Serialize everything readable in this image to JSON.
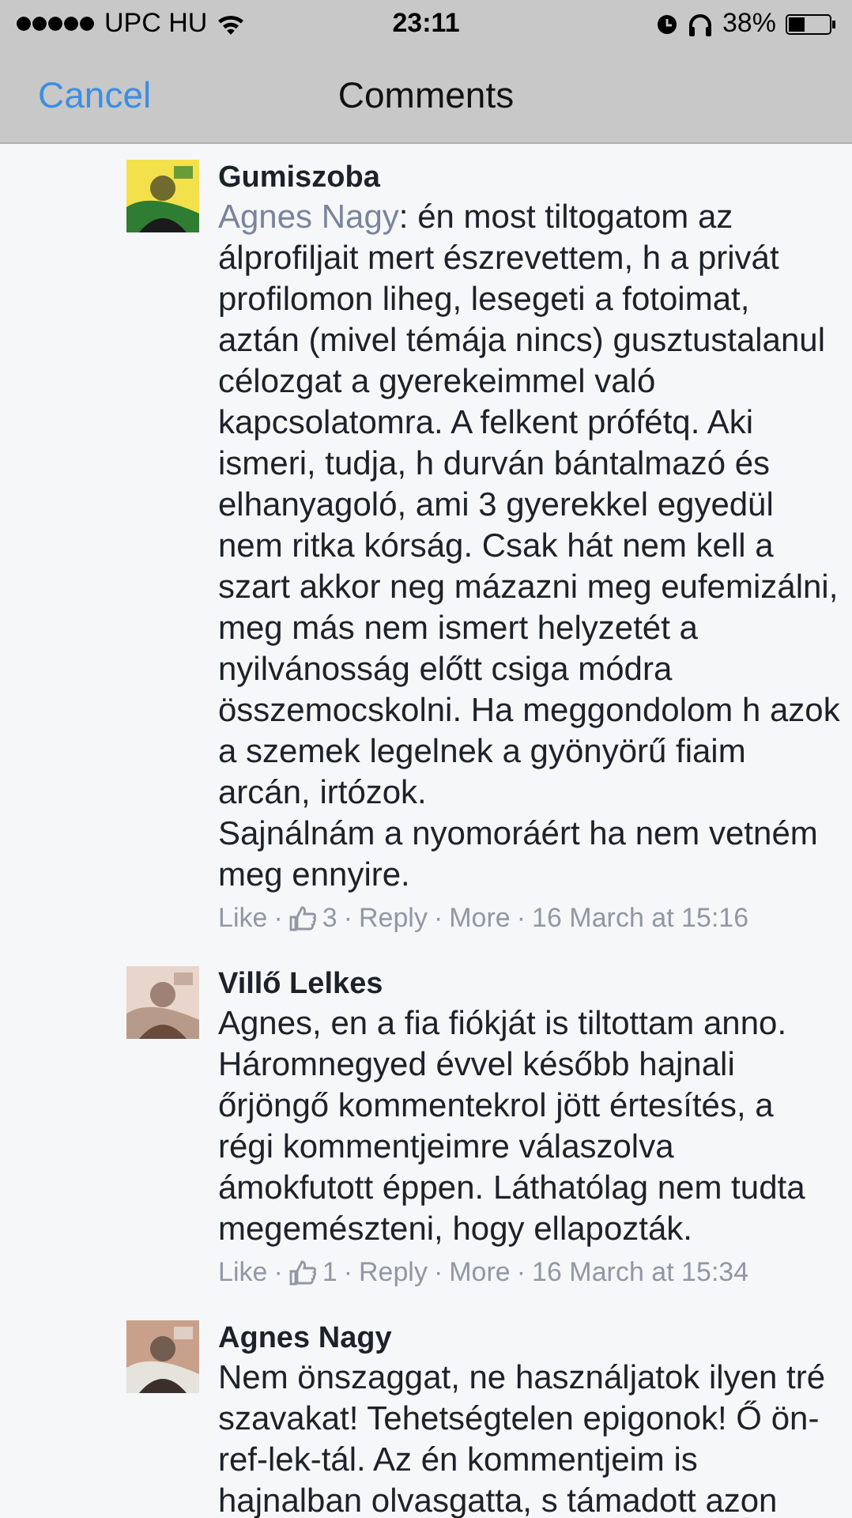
{
  "status_bar": {
    "carrier": "UPC HU",
    "time": "23:11",
    "battery": "38%"
  },
  "nav_bar": {
    "cancel": "Cancel",
    "title": "Comments"
  },
  "comments": [
    {
      "author": "Gumiszoba",
      "mention": "Agnes Nagy",
      "body": ": én most tiltogatom az\nálprofiljait mert észrevettem, h a privát\nprofilomon liheg, lesegeti a fotoimat,\naztán (mivel témája nincs) gusztustalanul\ncélozgat a gyerekeimmel való\nkapcsolatomra. A felkent prófétq. Aki\nismeri, tudja, h durván bántalmazó és\nelhanyagoló, ami 3 gyerekkel egyedül\nnem ritka kórság. Csak hát nem kell a\nszart akkor neg mázazni meg eufemizálni,\nmeg más nem ismert helyzetét a\nnyilvánosság előtt csiga módra\nösszemocskolni. Ha meggondolom h azok\na szemek legelnek a gyönyörű fiaim\narcán, irtózok.\nSajnálnám a nyomoráért ha nem vetném\nmeg ennyire.",
      "meta": [
        {
          "kind": "like",
          "text": "Like"
        },
        {
          "kind": "separator",
          "text": "·"
        },
        {
          "kind": "likes",
          "text": "3"
        },
        {
          "kind": "separator",
          "text": "·"
        },
        {
          "kind": "reply",
          "text": "Reply"
        },
        {
          "kind": "separator",
          "text": "·"
        },
        {
          "kind": "more",
          "text": "More"
        },
        {
          "kind": "separator",
          "text": "·"
        },
        {
          "kind": "time",
          "text": "16 March at 15:16"
        }
      ]
    },
    {
      "author": "Villő Lelkes",
      "body": "Agnes, en a fia fiókját is tiltottam anno.\nHáromnegyed évvel később hajnali\nőrjöngő kommentekrol jött értesítés, a\nrégi kommentjeimre válaszolva\námokfutott éppen. Láthatólag nem tudta\nmegemészteni, hogy ellapozták.",
      "meta": [
        {
          "kind": "like",
          "text": "Like"
        },
        {
          "kind": "separator",
          "text": "·"
        },
        {
          "kind": "likes",
          "text": "1"
        },
        {
          "kind": "separator",
          "text": "·"
        },
        {
          "kind": "reply",
          "text": "Reply"
        },
        {
          "kind": "separator",
          "text": "·"
        },
        {
          "kind": "more",
          "text": "More"
        },
        {
          "kind": "separator",
          "text": "·"
        },
        {
          "kind": "time",
          "text": "16 March at 15:34"
        }
      ]
    },
    {
      "author": "Agnes Nagy",
      "body": "Nem önszaggat, ne használjatok ilyen tré\nszavakat! Tehetségtelen epigonok! Ő ön-\nref-lek-tál. Az én kommentjeim is\nhajnalban olvasgatta, s támadott azon"
    }
  ]
}
